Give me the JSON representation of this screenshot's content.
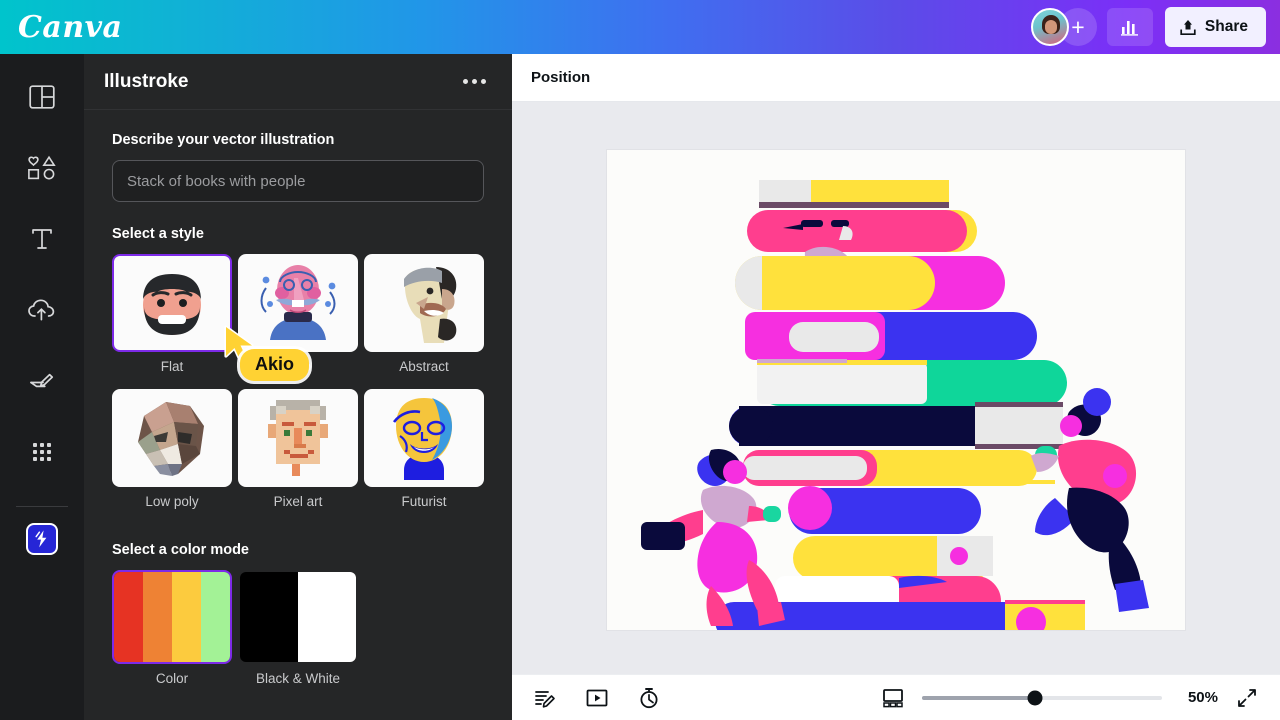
{
  "topbar": {
    "brand": "Canva",
    "avatar_icon": "user-avatar",
    "add_member_label": "+",
    "analytics_icon": "bar-chart-icon",
    "share_icon": "upload-icon",
    "share_label": "Share"
  },
  "rail": {
    "items": [
      {
        "icon": "design-templates-icon",
        "name": "sidebar-item-design"
      },
      {
        "icon": "elements-shapes-icon",
        "name": "sidebar-item-elements"
      },
      {
        "icon": "text-icon",
        "name": "sidebar-item-text"
      },
      {
        "icon": "cloud-upload-icon",
        "name": "sidebar-item-uploads"
      },
      {
        "icon": "draw-pen-icon",
        "name": "sidebar-item-draw"
      },
      {
        "icon": "apps-grid-icon",
        "name": "sidebar-item-apps"
      }
    ],
    "active_app": {
      "icon": "illustroke-lightning-icon",
      "name": "sidebar-app-illustroke"
    }
  },
  "panel": {
    "title": "Illustroke",
    "more_icon": "more-options-icon",
    "prompt": {
      "label": "Describe your vector illustration",
      "value": "",
      "placeholder": "Stack of books with people"
    },
    "style": {
      "label": "Select a style",
      "selected": "Flat",
      "options": [
        {
          "label": "Flat",
          "selected": true
        },
        {
          "label": "Akio",
          "selected": false
        },
        {
          "label": "Abstract",
          "selected": false
        },
        {
          "label": "Low poly",
          "selected": false
        },
        {
          "label": "Pixel art",
          "selected": false
        },
        {
          "label": "Futurist",
          "selected": false
        }
      ]
    },
    "color_mode": {
      "label": "Select a color mode",
      "selected": "Color",
      "options": [
        {
          "label": "Color",
          "selected": true,
          "swatches": [
            "#e63323",
            "#ee8234",
            "#fccb3e",
            "#a3f296"
          ]
        },
        {
          "label": "Black & White",
          "selected": false,
          "swatches": [
            "#000000",
            "#ffffff"
          ]
        }
      ]
    }
  },
  "cursor": {
    "label": "Akio",
    "pointer_color": "#ffd233",
    "pill_color": "#ffd233"
  },
  "editor": {
    "position_label": "Position",
    "bottom_tools": [
      {
        "icon": "notes-edit-icon",
        "name": "notes-button"
      },
      {
        "icon": "present-play-icon",
        "name": "present-button"
      },
      {
        "icon": "timer-icon",
        "name": "timer-button"
      }
    ],
    "page_view_icon": "page-view-icon",
    "zoom": {
      "value": "50%",
      "percent": 47
    },
    "fullscreen_icon": "fullscreen-icon"
  },
  "colors": {
    "brand_gradient_start": "#00c4cc",
    "brand_gradient_mid": "#3f6ff0",
    "brand_gradient_end": "#8b2fe0",
    "panel_bg": "#252627",
    "rail_bg": "#1b1c1e",
    "selection_purple": "#7d2ae8",
    "canvas_bg": "#e9eaee",
    "page_bg": "#fcfcfa"
  },
  "illustration": {
    "name": "stack-of-books-with-people",
    "palette": {
      "yellow": "#ffe13c",
      "pink": "#ff3e8e",
      "magenta": "#f62fe0",
      "blue": "#3b33f0",
      "navy": "#0a0a3c",
      "green": "#0fd69a",
      "teal": "#19d6a0",
      "offwhite": "#e9e9e9",
      "mauve": "#cfa8d0",
      "plum": "#6b4a66"
    }
  }
}
